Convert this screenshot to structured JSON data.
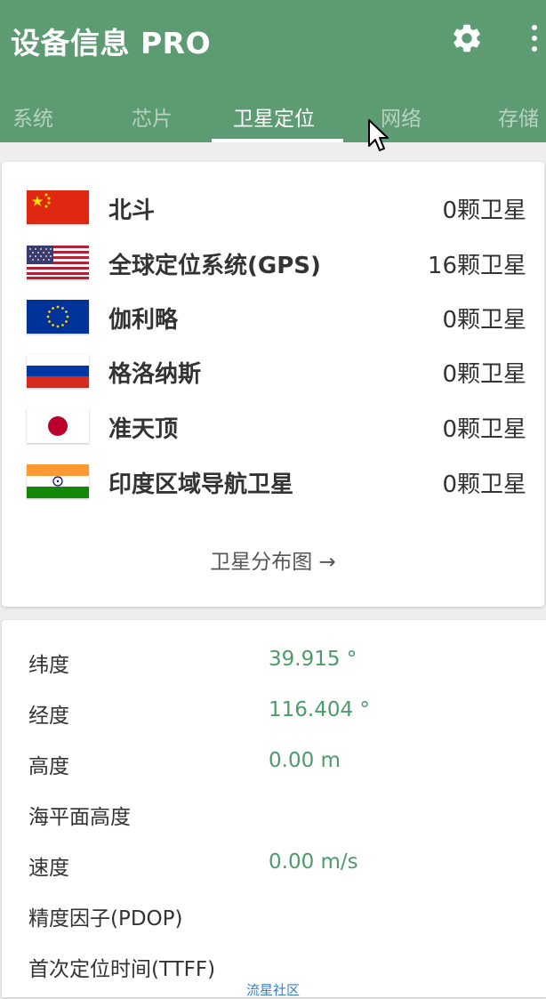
{
  "app": {
    "title": "设备信息 PRO",
    "settings_icon": "gear-icon",
    "more_icon": "more-vertical-icon"
  },
  "tabs": [
    {
      "label": "系统",
      "active": false
    },
    {
      "label": "芯片",
      "active": false
    },
    {
      "label": "卫星定位",
      "active": true
    },
    {
      "label": "网络",
      "active": false
    },
    {
      "label": "存储",
      "active": false
    }
  ],
  "satellites": [
    {
      "flag": "china-flag-icon",
      "name": "北斗",
      "count": "0颗卫星"
    },
    {
      "flag": "usa-flag-icon",
      "name": "全球定位系统(GPS)",
      "count": "16颗卫星"
    },
    {
      "flag": "eu-flag-icon",
      "name": "伽利略",
      "count": "0颗卫星"
    },
    {
      "flag": "russia-flag-icon",
      "name": "格洛纳斯",
      "count": "0颗卫星"
    },
    {
      "flag": "japan-flag-icon",
      "name": "准天顶",
      "count": "0颗卫星"
    },
    {
      "flag": "india-flag-icon",
      "name": "印度区域导航卫星",
      "count": "0颗卫星"
    }
  ],
  "sky_map_link": "卫星分布图 →",
  "location": [
    {
      "label": "纬度",
      "value": "39.915 °"
    },
    {
      "label": "经度",
      "value": "116.404 °"
    },
    {
      "label": "高度",
      "value": "0.00 m"
    },
    {
      "label": "海平面高度",
      "value": ""
    },
    {
      "label": "速度",
      "value": "0.00 m/s"
    },
    {
      "label": "精度因子(PDOP)",
      "value": ""
    },
    {
      "label": "首次定位时间(TTFF)",
      "value": ""
    }
  ],
  "watermark": "流星社区",
  "colors": {
    "appbar": "#5d9b73",
    "value_green": "#4f9a6a",
    "background": "#eeeeee"
  }
}
